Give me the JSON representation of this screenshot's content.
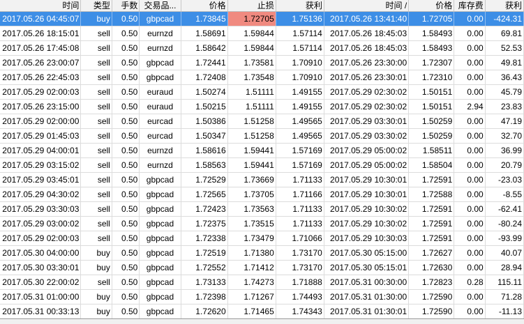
{
  "columns": [
    "时间",
    "类型",
    "手数",
    "交易品...",
    "价格",
    "止损",
    "获利",
    "时间 /",
    "价格",
    "库存费",
    "获利"
  ],
  "rows": [
    [
      "2017.05.26 04:45:07",
      "buy",
      "0.50",
      "gbpcad",
      "1.73845",
      "1.72705",
      "1.75136",
      "2017.05.26 13:41:40",
      "1.72705",
      "0.00",
      "-424.31"
    ],
    [
      "2017.05.26 18:15:01",
      "sell",
      "0.50",
      "eurnzd",
      "1.58691",
      "1.59844",
      "1.57114",
      "2017.05.26 18:45:03",
      "1.58493",
      "0.00",
      "69.81"
    ],
    [
      "2017.05.26 17:45:08",
      "sell",
      "0.50",
      "eurnzd",
      "1.58642",
      "1.59844",
      "1.57114",
      "2017.05.26 18:45:03",
      "1.58493",
      "0.00",
      "52.53"
    ],
    [
      "2017.05.26 23:00:07",
      "sell",
      "0.50",
      "gbpcad",
      "1.72441",
      "1.73581",
      "1.70910",
      "2017.05.26 23:30:00",
      "1.72307",
      "0.00",
      "49.81"
    ],
    [
      "2017.05.26 22:45:03",
      "sell",
      "0.50",
      "gbpcad",
      "1.72408",
      "1.73548",
      "1.70910",
      "2017.05.26 23:30:01",
      "1.72310",
      "0.00",
      "36.43"
    ],
    [
      "2017.05.29 02:00:03",
      "sell",
      "0.50",
      "euraud",
      "1.50274",
      "1.51111",
      "1.49155",
      "2017.05.29 02:30:02",
      "1.50151",
      "0.00",
      "45.79"
    ],
    [
      "2017.05.26 23:15:00",
      "sell",
      "0.50",
      "euraud",
      "1.50215",
      "1.51111",
      "1.49155",
      "2017.05.29 02:30:02",
      "1.50151",
      "2.94",
      "23.83"
    ],
    [
      "2017.05.29 02:00:00",
      "sell",
      "0.50",
      "eurcad",
      "1.50386",
      "1.51258",
      "1.49565",
      "2017.05.29 03:30:01",
      "1.50259",
      "0.00",
      "47.19"
    ],
    [
      "2017.05.29 01:45:03",
      "sell",
      "0.50",
      "eurcad",
      "1.50347",
      "1.51258",
      "1.49565",
      "2017.05.29 03:30:02",
      "1.50259",
      "0.00",
      "32.70"
    ],
    [
      "2017.05.29 04:00:01",
      "sell",
      "0.50",
      "eurnzd",
      "1.58616",
      "1.59441",
      "1.57169",
      "2017.05.29 05:00:02",
      "1.58511",
      "0.00",
      "36.99"
    ],
    [
      "2017.05.29 03:15:02",
      "sell",
      "0.50",
      "eurnzd",
      "1.58563",
      "1.59441",
      "1.57169",
      "2017.05.29 05:00:02",
      "1.58504",
      "0.00",
      "20.79"
    ],
    [
      "2017.05.29 03:45:01",
      "sell",
      "0.50",
      "gbpcad",
      "1.72529",
      "1.73669",
      "1.71133",
      "2017.05.29 10:30:01",
      "1.72591",
      "0.00",
      "-23.03"
    ],
    [
      "2017.05.29 04:30:02",
      "sell",
      "0.50",
      "gbpcad",
      "1.72565",
      "1.73705",
      "1.71166",
      "2017.05.29 10:30:01",
      "1.72588",
      "0.00",
      "-8.55"
    ],
    [
      "2017.05.29 03:30:03",
      "sell",
      "0.50",
      "gbpcad",
      "1.72423",
      "1.73563",
      "1.71133",
      "2017.05.29 10:30:02",
      "1.72591",
      "0.00",
      "-62.41"
    ],
    [
      "2017.05.29 03:00:02",
      "sell",
      "0.50",
      "gbpcad",
      "1.72375",
      "1.73515",
      "1.71133",
      "2017.05.29 10:30:02",
      "1.72591",
      "0.00",
      "-80.24"
    ],
    [
      "2017.05.29 02:00:03",
      "sell",
      "0.50",
      "gbpcad",
      "1.72338",
      "1.73479",
      "1.71066",
      "2017.05.29 10:30:03",
      "1.72591",
      "0.00",
      "-93.99"
    ],
    [
      "2017.05.30 04:00:00",
      "buy",
      "0.50",
      "gbpcad",
      "1.72519",
      "1.71380",
      "1.73170",
      "2017.05.30 05:15:00",
      "1.72627",
      "0.00",
      "40.07"
    ],
    [
      "2017.05.30 03:30:01",
      "buy",
      "0.50",
      "gbpcad",
      "1.72552",
      "1.71412",
      "1.73170",
      "2017.05.30 05:15:01",
      "1.72630",
      "0.00",
      "28.94"
    ],
    [
      "2017.05.30 22:00:02",
      "sell",
      "0.50",
      "gbpcad",
      "1.73133",
      "1.74273",
      "1.71888",
      "2017.05.31 00:30:00",
      "1.72823",
      "0.28",
      "115.11"
    ],
    [
      "2017.05.31 01:00:00",
      "buy",
      "0.50",
      "gbpcad",
      "1.72398",
      "1.71267",
      "1.74493",
      "2017.05.31 01:30:00",
      "1.72590",
      "0.00",
      "71.28"
    ],
    [
      "2017.05.31 00:33:13",
      "buy",
      "0.50",
      "gbpcad",
      "1.72620",
      "1.71465",
      "1.74343",
      "2017.05.31 01:30:01",
      "1.72590",
      "0.00",
      "-11.13"
    ]
  ],
  "selected_row": 0,
  "highlighted_cell": {
    "row": 0,
    "col": 5,
    "color": "#f08a80"
  },
  "colors": {
    "selection": "#3d8ee6",
    "header_bg": "#f2f2f2",
    "grid_line": "#dcdcdc"
  }
}
